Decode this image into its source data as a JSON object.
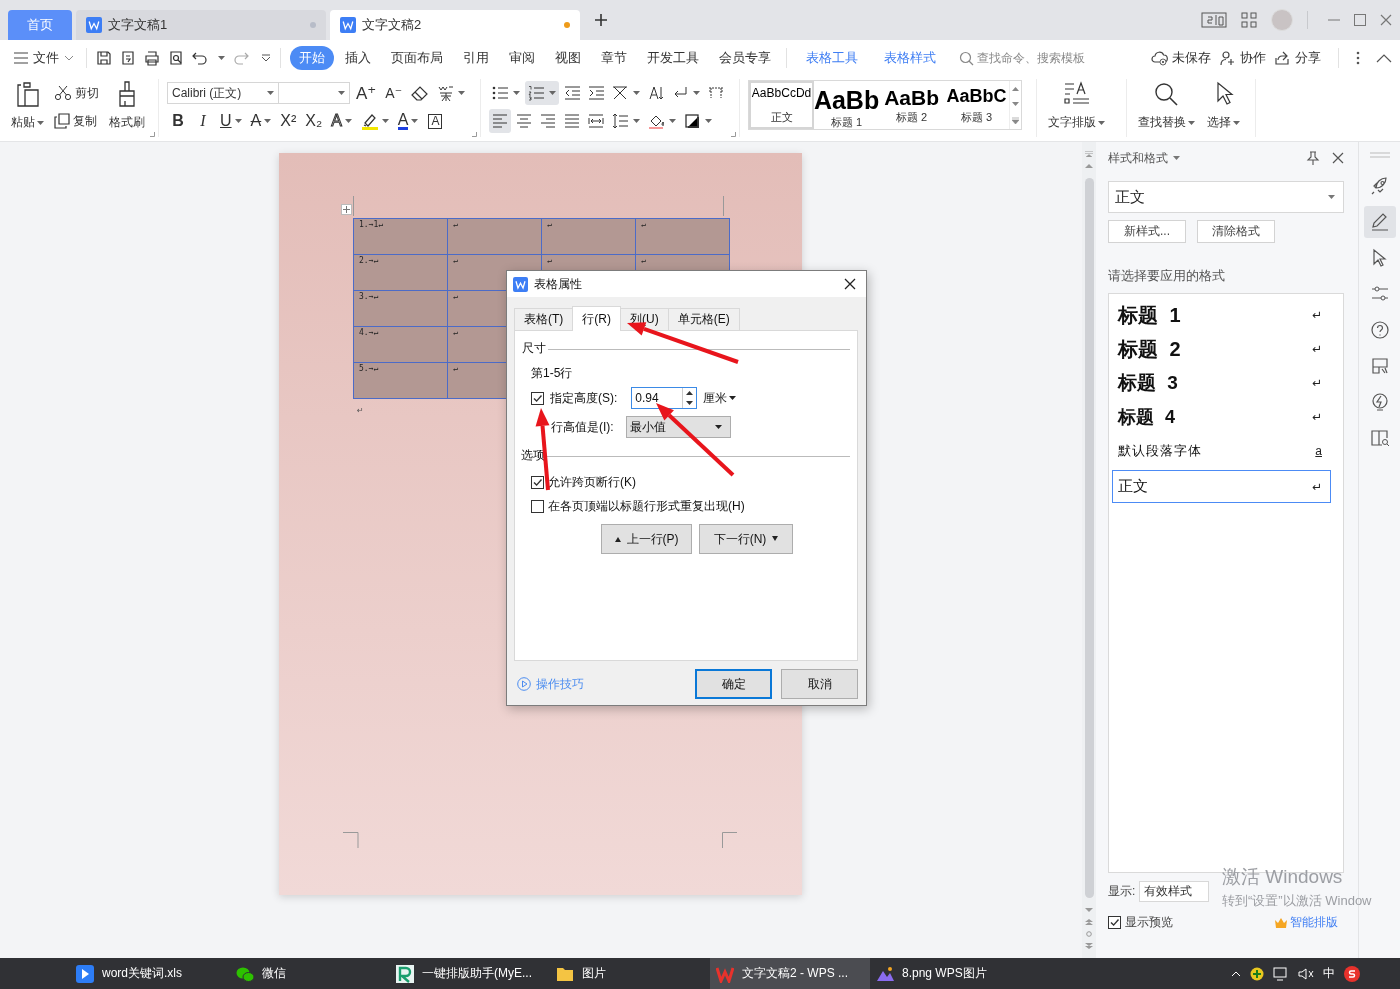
{
  "title_bar": {
    "tabs": [
      {
        "label": "首页",
        "kind": "home",
        "selected": false
      },
      {
        "label": "文字文稿1",
        "kind": "doc",
        "selected": false,
        "modified": false
      },
      {
        "label": "文字文稿2",
        "kind": "doc",
        "selected": true,
        "modified": true
      }
    ]
  },
  "menu_bar": {
    "file_label": "文件",
    "ribbon_tabs": [
      {
        "label": "开始",
        "kind": "main",
        "selected": true
      },
      {
        "label": "插入",
        "kind": "main",
        "selected": false
      },
      {
        "label": "页面布局",
        "kind": "main",
        "selected": false
      },
      {
        "label": "引用",
        "kind": "main",
        "selected": false
      },
      {
        "label": "审阅",
        "kind": "main",
        "selected": false
      },
      {
        "label": "视图",
        "kind": "main",
        "selected": false
      },
      {
        "label": "章节",
        "kind": "main",
        "selected": false
      },
      {
        "label": "开发工具",
        "kind": "main",
        "selected": false
      },
      {
        "label": "会员专享",
        "kind": "main",
        "selected": false
      },
      {
        "label": "表格工具",
        "kind": "context",
        "selected": false
      },
      {
        "label": "表格样式",
        "kind": "context",
        "selected": false
      }
    ],
    "search": {
      "placeholder": "查找命令、搜索模板"
    },
    "actions": [
      {
        "label": "未保存",
        "kind": "cloud"
      },
      {
        "label": "协作",
        "kind": "people"
      },
      {
        "label": "分享",
        "kind": "share"
      }
    ]
  },
  "ribbon": {
    "clipboard": {
      "paste": "粘贴",
      "cut": "剪切",
      "copy": "复制",
      "format_painter": "格式刷"
    },
    "font": {
      "name": "Calibri (正文)",
      "size_glyphs": [
        {
          "glyph": "A⁺",
          "kind": "grow"
        },
        {
          "glyph": "A⁻",
          "kind": "shrink"
        }
      ],
      "format_glyphs": [
        {
          "glyph": "B",
          "kind": "bold"
        },
        {
          "glyph": "I",
          "kind": "italic"
        },
        {
          "glyph": "U",
          "kind": "underline"
        },
        {
          "glyph": "A",
          "kind": "strike"
        },
        {
          "glyph": "X²",
          "kind": "superscript"
        },
        {
          "glyph": "X₂",
          "kind": "subscript"
        },
        {
          "glyph": "A",
          "kind": "effect"
        },
        {
          "kind": "highlight"
        },
        {
          "glyph": "A",
          "kind": "color"
        },
        {
          "glyph": "A",
          "kind": "boxed"
        }
      ]
    },
    "paragraph_rows": [
      [
        {
          "kind": "bullets",
          "selected": false
        },
        {
          "kind": "numbering",
          "selected": true
        },
        {
          "kind": "outdent",
          "selected": false
        },
        {
          "kind": "indent",
          "selected": false
        },
        {
          "kind": "asian",
          "selected": false
        },
        {
          "kind": "sort",
          "selected": false
        },
        {
          "kind": "marks",
          "selected": false
        },
        {
          "kind": "grid",
          "selected": false
        }
      ],
      [
        {
          "kind": "left",
          "selected": true
        },
        {
          "kind": "center",
          "selected": false
        },
        {
          "kind": "right",
          "selected": false
        },
        {
          "kind": "justify",
          "selected": false
        },
        {
          "kind": "distribute",
          "selected": false
        },
        {
          "kind": "spacing",
          "selected": false
        },
        {
          "kind": "shading",
          "selected": false
        },
        {
          "kind": "border",
          "selected": false
        }
      ]
    ],
    "style_gallery": [
      {
        "preview": "AaBbCcDd",
        "label": "正文",
        "kind": "body",
        "selected": true
      },
      {
        "preview": "AaBb",
        "label": "标题 1",
        "kind": "h1",
        "selected": false
      },
      {
        "preview": "AaBb",
        "label": "标题 2",
        "kind": "h2",
        "selected": false
      },
      {
        "preview": "AaBbC",
        "label": "标题 3",
        "kind": "h3",
        "selected": false
      }
    ],
    "big_tools": [
      {
        "label": "文字排版",
        "kind": "layout"
      },
      {
        "label": "查找替换",
        "kind": "find"
      },
      {
        "label": "选择",
        "kind": "select"
      }
    ]
  },
  "document": {
    "table": {
      "rows": [
        [
          "1.→1↵",
          "↵",
          "↵",
          "↵"
        ],
        [
          "2.→↵",
          "↵",
          "↵",
          "↵"
        ],
        [
          "3.→↵",
          "↵"
        ],
        [
          "4.→↵",
          "↵"
        ],
        [
          "5.→↵",
          "↵"
        ]
      ]
    },
    "after_table_mark": "↵"
  },
  "dialog": {
    "title": "表格属性",
    "tabs": [
      {
        "label": "表格(T)",
        "selected": false
      },
      {
        "label": "行(R)",
        "selected": true
      },
      {
        "label": "列(U)",
        "selected": false
      },
      {
        "label": "单元格(E)",
        "selected": false
      }
    ],
    "size_section": "尺寸",
    "rows_label": "第1-5行",
    "height": {
      "label": "指定高度(S):",
      "checked": true,
      "value": "0.94",
      "unit": "厘米"
    },
    "height_rule": {
      "label": "行高值是(I):",
      "value": "最小值"
    },
    "options_section": "选项",
    "options": [
      {
        "label": "允许跨页断行(K)",
        "checked": true
      },
      {
        "label": "在各页顶端以标题行形式重复出现(H)",
        "checked": false
      }
    ],
    "prev_button": "上一行(P)",
    "next_button": "下一行(N)",
    "tips_link": "操作技巧",
    "ok_button": "确定",
    "cancel_button": "取消"
  },
  "style_pane": {
    "title": "样式和格式",
    "current_style": "正文",
    "buttons": [
      "新样式...",
      "清除格式"
    ],
    "prompt": "请选择要应用的格式",
    "styles": [
      {
        "label": "标题 1",
        "kind": "h1",
        "mark": "↵",
        "selected": false
      },
      {
        "label": "标题 2",
        "kind": "h2",
        "mark": "↵",
        "selected": false
      },
      {
        "label": "标题 3",
        "kind": "h3",
        "mark": "↵",
        "selected": false
      },
      {
        "label": "标题 4",
        "kind": "h4",
        "mark": "↵",
        "selected": false
      },
      {
        "label": "默认段落字体",
        "kind": "char",
        "mark": "a",
        "selected": false
      },
      {
        "label": "正文",
        "kind": "body",
        "mark": "↵",
        "selected": true
      }
    ],
    "show_label": "显示:",
    "show_value": "有效样式",
    "preview": {
      "label": "显示预览",
      "checked": true
    },
    "smart_layout": "智能排版"
  },
  "sidebar": {
    "tools": [
      {
        "kind": "rocket",
        "selected": false
      },
      {
        "kind": "pen",
        "selected": true
      },
      {
        "kind": "pointer",
        "selected": false
      },
      {
        "kind": "sliders",
        "selected": false
      },
      {
        "kind": "help",
        "selected": false
      },
      {
        "kind": "brush",
        "selected": false
      },
      {
        "kind": "bolt",
        "selected": false
      },
      {
        "kind": "book",
        "selected": false
      }
    ]
  },
  "taskbar": {
    "items": [
      {
        "label": "word关键词.xls",
        "kind": "app",
        "selected": false
      },
      {
        "label": "微信",
        "kind": "chat",
        "selected": false
      },
      {
        "label": "一键排版助手(MyE...",
        "kind": "logo",
        "selected": false
      },
      {
        "label": "图片",
        "kind": "folder",
        "selected": false
      },
      {
        "label": "文字文稿2 - WPS ...",
        "kind": "wps",
        "selected": true
      },
      {
        "label": "8.png  WPS图片",
        "kind": "image",
        "selected": false
      }
    ],
    "ime": "中"
  },
  "windows_activation": {
    "title": "激活 Windows",
    "subtitle": "转到“设置”以激活 Window"
  }
}
